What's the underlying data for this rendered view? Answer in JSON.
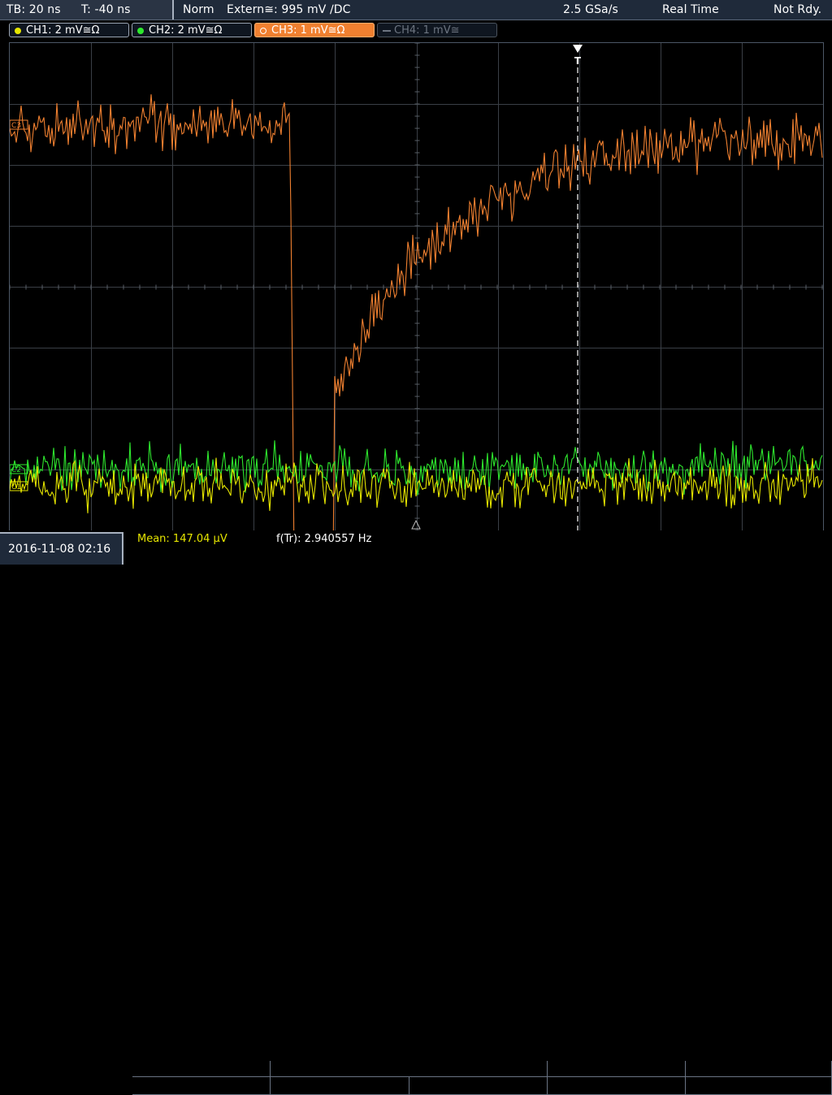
{
  "status": {
    "timebase": "TB: 20 ns",
    "trigger_offset": "T: -40 ns",
    "mode": "Norm",
    "trigger_source": "Extern≅: 995 mV ∕DC",
    "sample_rate": "2.5 GSa/s",
    "acq_mode": "Real Time",
    "state": "Not Rdy."
  },
  "channels": [
    {
      "label": "CH1: 2 mV≅Ω",
      "color": "#e6e600",
      "state": "on"
    },
    {
      "label": "CH2: 2 mV≅Ω",
      "color": "#2ee82e",
      "state": "on"
    },
    {
      "label": "CH3: 1 mV≅Ω",
      "color": "#f08030",
      "state": "active"
    },
    {
      "label": "CH4: 1 mV≅",
      "color": "#6c7480",
      "state": "off"
    }
  ],
  "markers": {
    "ch3": "C3",
    "ch2": "C2",
    "ch1": "C1",
    "trigger": "T"
  },
  "footer": {
    "datetime": "2016-11-08 02:16",
    "mean": "Mean: 147.04 µV",
    "freq": "f(Tr): 2.940557 Hz"
  }
}
